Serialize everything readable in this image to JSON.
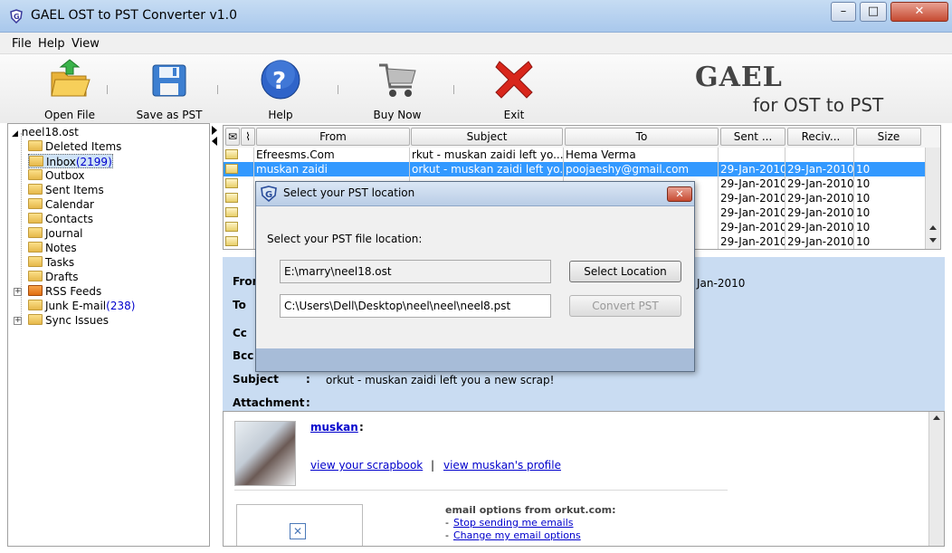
{
  "window": {
    "title": "GAEL OST to PST Converter v1.0",
    "icon": "gael-shield-icon",
    "minimize": "–",
    "maximize": "□",
    "close": "✕"
  },
  "menu": [
    "File",
    "Help",
    "View"
  ],
  "toolbar": {
    "open_file": "Open File",
    "save_as_pst": "Save as PST",
    "help": "Help",
    "buy_now": "Buy Now",
    "exit": "Exit"
  },
  "brand": {
    "name": "GAEL",
    "tagline": "for OST to PST"
  },
  "tree": {
    "root": "neel18.ost",
    "folders": [
      {
        "label": "Deleted Items",
        "count": ""
      },
      {
        "label": "Inbox",
        "count": "(2199)"
      },
      {
        "label": "Outbox",
        "count": ""
      },
      {
        "label": "Sent Items",
        "count": ""
      },
      {
        "label": "Calendar",
        "count": ""
      },
      {
        "label": "Contacts",
        "count": ""
      },
      {
        "label": "Journal",
        "count": ""
      },
      {
        "label": "Notes",
        "count": ""
      },
      {
        "label": "Tasks",
        "count": ""
      },
      {
        "label": "Drafts",
        "count": ""
      },
      {
        "label": "RSS Feeds",
        "count": ""
      },
      {
        "label": "Junk E-mail",
        "count": "(238)"
      },
      {
        "label": "Sync Issues",
        "count": ""
      }
    ]
  },
  "grid": {
    "columns": [
      "From",
      "Subject",
      "To",
      "Sent ...",
      "Reciv...",
      "Size"
    ],
    "rows": [
      {
        "from": "Efreesms.Com",
        "subject": "rkut - muskan zaidi left yo...",
        "to": "Hema Verma",
        "sent": "",
        "received": "",
        "size": ""
      },
      {
        "from": "muskan zaidi",
        "subject": "orkut - muskan zaidi left yo...",
        "to": "poojaeshy@gmail.com",
        "sent": "29-Jan-2010",
        "received": "29-Jan-2010",
        "size": "10"
      },
      {
        "from": "",
        "subject": "",
        "to": "",
        "sent": "29-Jan-2010",
        "received": "29-Jan-2010",
        "size": "10"
      },
      {
        "from": "",
        "subject": "",
        "to": "",
        "sent": "29-Jan-2010",
        "received": "29-Jan-2010",
        "size": "10"
      },
      {
        "from": "",
        "subject": "",
        "to": "",
        "sent": "29-Jan-2010",
        "received": "29-Jan-2010",
        "size": "10"
      },
      {
        "from": "",
        "subject": "",
        "to": "",
        "sent": "29-Jan-2010",
        "received": "29-Jan-2010",
        "size": "10"
      },
      {
        "from": "",
        "subject": "",
        "to": "",
        "sent": "29-Jan-2010",
        "received": "29-Jan-2010",
        "size": "10"
      }
    ]
  },
  "details": {
    "from_label": "From",
    "to_label": "To",
    "cc_label": "Cc",
    "bcc_label": "Bcc",
    "subject_label": "Subject",
    "attachment_label": "Attachment",
    "colon": ":",
    "date_fragment": "Jan-2010",
    "subject_value": "orkut - muskan zaidi left you a new scrap!"
  },
  "mail": {
    "sender_link": "muskan",
    "sender_suffix": ":",
    "scrapbook_link": "view your scrapbook",
    "separator": "|",
    "profile_link": "view muskan's profile",
    "options_heading": "email options from orkut.com:",
    "stop_link": "Stop sending me emails",
    "change_link": "Change my email options",
    "dash": "-"
  },
  "dialog": {
    "title": "Select your PST location",
    "prompt": "Select your PST file location:",
    "ost_path": "E:\\marry\\neel18.ost",
    "pst_path": "C:\\Users\\Dell\\Desktop\\neel\\neel\\neel8.pst",
    "select_location": "Select Location",
    "convert_pst": "Convert PST",
    "close": "✕"
  }
}
